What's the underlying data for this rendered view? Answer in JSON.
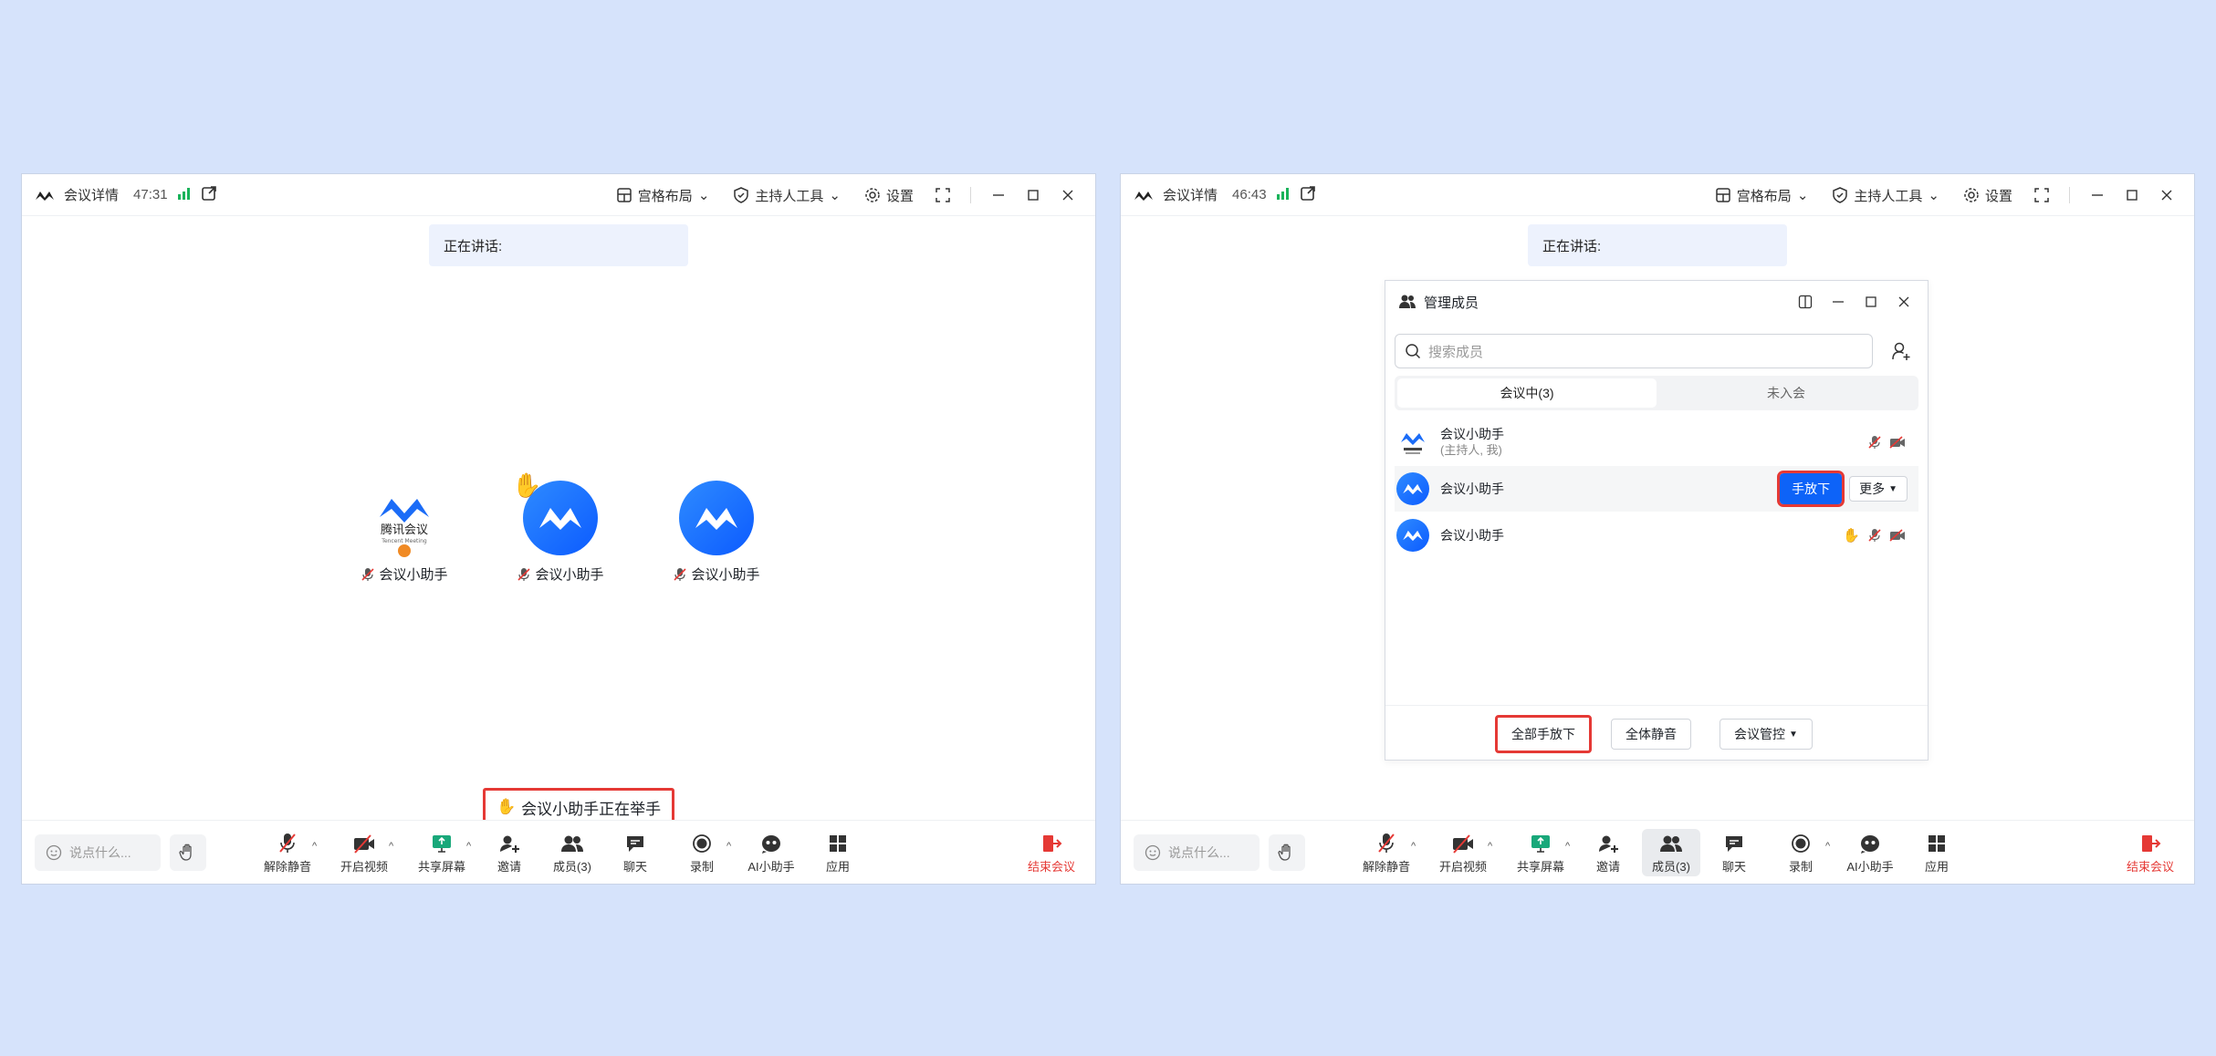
{
  "left": {
    "title": "会议详情",
    "time": "47:31",
    "layout_label": "宫格布局",
    "host_tools_label": "主持人工具",
    "settings_label": "设置",
    "speaking_label": "正在讲话:",
    "participants": [
      {
        "name": "会议小助手",
        "avatar": "tencent-meeting-logo",
        "brand_text": "腾讯会议",
        "brand_sub": "Tencent Meeting"
      },
      {
        "name": "会议小助手",
        "avatar": "blue-logo",
        "hand_raised": true
      },
      {
        "name": "会议小助手",
        "avatar": "blue-logo"
      }
    ],
    "toast": "会议小助手正在举手",
    "chat_placeholder": "说点什么...",
    "toolbar": {
      "unmute": "解除静音",
      "video": "开启视频",
      "share": "共享屏幕",
      "invite": "邀请",
      "members": "成员(3)",
      "chat": "聊天",
      "record": "录制",
      "ai": "AI小助手",
      "apps": "应用",
      "end": "结束会议"
    }
  },
  "right": {
    "title": "会议详情",
    "time": "46:43",
    "layout_label": "宫格布局",
    "host_tools_label": "主持人工具",
    "settings_label": "设置",
    "speaking_label": "正在讲话:",
    "panel": {
      "title": "管理成员",
      "search_placeholder": "搜索成员",
      "tab_in": "会议中(3)",
      "tab_out": "未入会",
      "members": [
        {
          "name": "会议小助手",
          "sub": "(主持人, 我)"
        },
        {
          "name": "会议小助手",
          "lower_hand": "手放下",
          "more": "更多"
        },
        {
          "name": "会议小助手"
        }
      ],
      "footer": {
        "lower_all": "全部手放下",
        "mute_all": "全体静音",
        "control": "会议管控"
      }
    },
    "chat_placeholder": "说点什么...",
    "toolbar": {
      "unmute": "解除静音",
      "video": "开启视频",
      "share": "共享屏幕",
      "invite": "邀请",
      "members": "成员(3)",
      "chat": "聊天",
      "record": "录制",
      "ai": "AI小助手",
      "apps": "应用",
      "end": "结束会议"
    }
  },
  "colors": {
    "background": "#d6e3fb",
    "accent_blue": "#0d63f8",
    "highlight_red": "#e53935",
    "signal_green": "#19b35a"
  }
}
